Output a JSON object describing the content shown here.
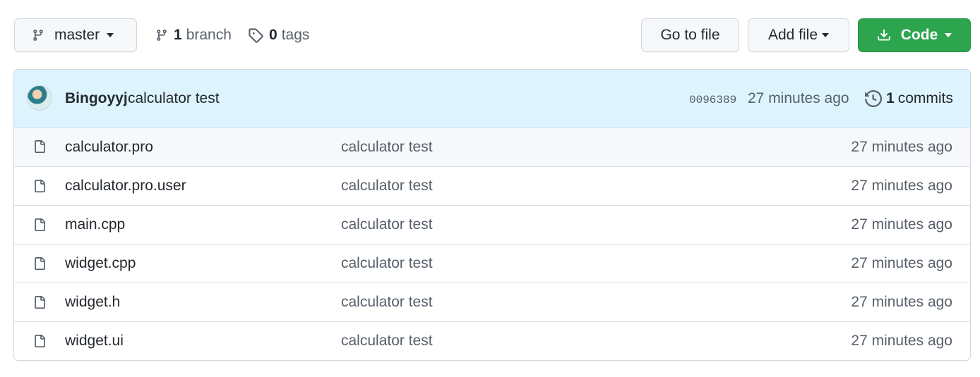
{
  "toolbar": {
    "branch_label": "master",
    "branch_count": "1",
    "branch_text": "branch",
    "tag_count": "0",
    "tag_text": "tags",
    "goto_file": "Go to file",
    "add_file": "Add file",
    "code": "Code"
  },
  "latest_commit": {
    "author": "Bingoyyj",
    "message": "calculator test",
    "sha": "0096389",
    "time": "27 minutes ago",
    "commits_count": "1",
    "commits_text": "commits"
  },
  "files": [
    {
      "name": "calculator.pro",
      "message": "calculator test",
      "time": "27 minutes ago"
    },
    {
      "name": "calculator.pro.user",
      "message": "calculator test",
      "time": "27 minutes ago"
    },
    {
      "name": "main.cpp",
      "message": "calculator test",
      "time": "27 minutes ago"
    },
    {
      "name": "widget.cpp",
      "message": "calculator test",
      "time": "27 minutes ago"
    },
    {
      "name": "widget.h",
      "message": "calculator test",
      "time": "27 minutes ago"
    },
    {
      "name": "widget.ui",
      "message": "calculator test",
      "time": "27 minutes ago"
    }
  ],
  "icons": {
    "branch": "git-branch-icon",
    "tag": "tag-icon",
    "download": "download-icon",
    "history": "history-icon",
    "file": "file-icon"
  },
  "colors": {
    "code_button": "#2da44e",
    "header_bg": "#ddf4ff",
    "muted_text": "#57606a"
  }
}
